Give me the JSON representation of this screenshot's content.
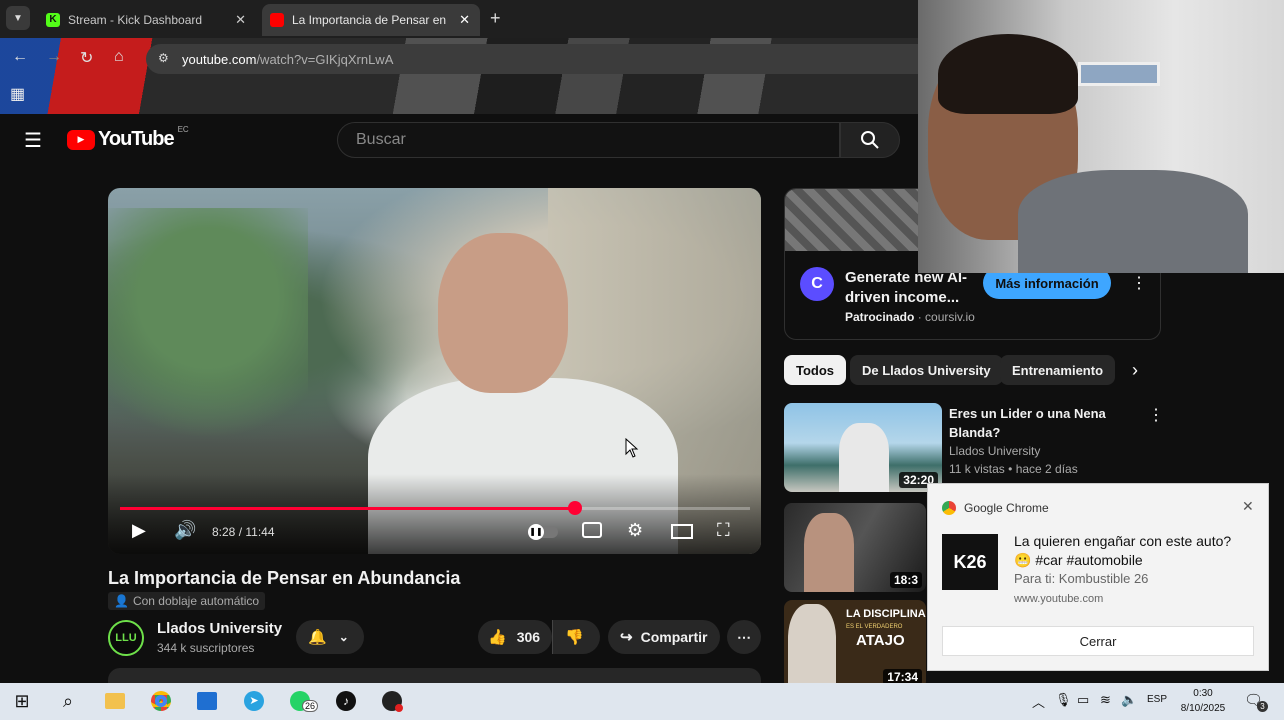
{
  "browser": {
    "tabs": [
      {
        "title": "Stream - Kick Dashboard",
        "favicon": "kick-icon",
        "favicon_color": "#53fc18",
        "active": false
      },
      {
        "title": "La Importancia de Pensar en Ab",
        "favicon": "youtube-icon",
        "favicon_color": "#ff0000",
        "active": true
      }
    ],
    "new_tab": "+",
    "url_host": "youtube.com",
    "url_path": "/watch?v=GIKjqXrnLwA"
  },
  "youtube": {
    "logo_text": "YouTube",
    "logo_region": "EC",
    "search_placeholder": "Buscar",
    "player": {
      "time_current": "8:28",
      "time_separator": "/",
      "time_total": "11:44",
      "progress_fraction": 0.722
    },
    "video_title": "La Importancia de Pensar en Abundancia",
    "dub_label": "Con doblaje automático",
    "channel": {
      "name": "Llados University",
      "subscribers": "344 k suscriptores",
      "avatar_text": "LLU"
    },
    "likes": "306",
    "share_label": "Compartir",
    "ad": {
      "title_line1": "Generate new AI-",
      "title_line2": "driven income...",
      "sponsored": "Patrocinado",
      "domain": "coursiv.io",
      "cta": "Más información"
    },
    "chips": [
      "Todos",
      "De Llados University",
      "Entrenamiento"
    ],
    "recommendations": [
      {
        "title_line1": "Eres un Lider o una Nena",
        "title_line2": "Blanda?",
        "channel": "Llados University",
        "views": "11 k vistas",
        "age": "hace 2 días",
        "duration": "32:20"
      },
      {
        "title_line1": "",
        "title_line2": "",
        "channel": "",
        "views": "",
        "age": "",
        "duration": "18:3"
      },
      {
        "title_line1": "",
        "title_line2": "",
        "channel": "",
        "views": "",
        "age": "",
        "duration": "17:34",
        "thumb_text1": "LA DISCIPLINA",
        "thumb_text2": "ES EL VERDADERO",
        "thumb_text3": "ATAJO"
      }
    ]
  },
  "notification": {
    "app": "Google Chrome",
    "title": "La quieren engañar con este auto?",
    "title_line2": "😬 #car #automobile",
    "subtitle": "Para ti: Kombustible 26",
    "source": "www.youtube.com",
    "icon_text": "K26",
    "button": "Cerrar"
  },
  "taskbar": {
    "language": "ESP",
    "time": "0:30",
    "date": "8/10/2025",
    "whatsapp_badge": "26",
    "notif_count": "3"
  }
}
